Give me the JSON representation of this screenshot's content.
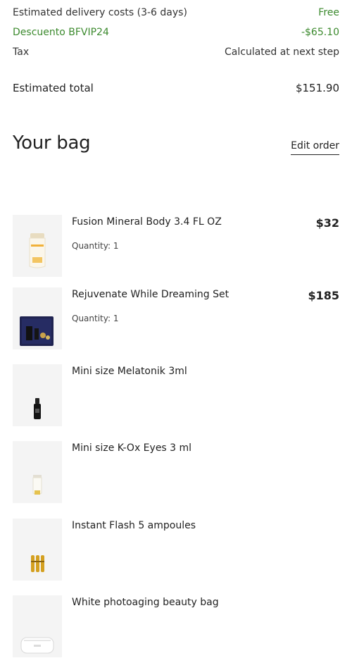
{
  "summary": {
    "delivery": {
      "label": "Estimated delivery costs (3-6 days)",
      "value": "Free"
    },
    "discount": {
      "label": "Descuento BFVIP24",
      "value": "-$65.10"
    },
    "tax": {
      "label": "Tax",
      "value": "Calculated at next step"
    },
    "total": {
      "label": "Estimated total",
      "value": "$151.90"
    }
  },
  "bag": {
    "title": "Your bag",
    "edit_label": "Edit order",
    "items": [
      {
        "name": "Fusion Mineral Body 3.4 FL OZ",
        "quantity": "Quantity: 1",
        "price": "$32",
        "icon": "sunscreen-tube-icon"
      },
      {
        "name": "Rejuvenate While Dreaming Set",
        "quantity": "Quantity: 1",
        "price": "$185",
        "icon": "gift-set-box-icon"
      },
      {
        "name": "Mini size Melatonik 3ml",
        "icon": "dropper-bottle-icon"
      },
      {
        "name": "Mini size K-Ox Eyes 3 ml",
        "icon": "mini-tube-icon"
      },
      {
        "name": "Instant Flash 5 ampoules",
        "icon": "ampoules-icon"
      },
      {
        "name": "White photoaging beauty bag",
        "icon": "beauty-bag-icon"
      }
    ]
  },
  "colors": {
    "green": "#3c8a2e",
    "thumb_bg": "#f4f4f4",
    "set_box": "#1f2350",
    "gold": "#d4a020"
  }
}
